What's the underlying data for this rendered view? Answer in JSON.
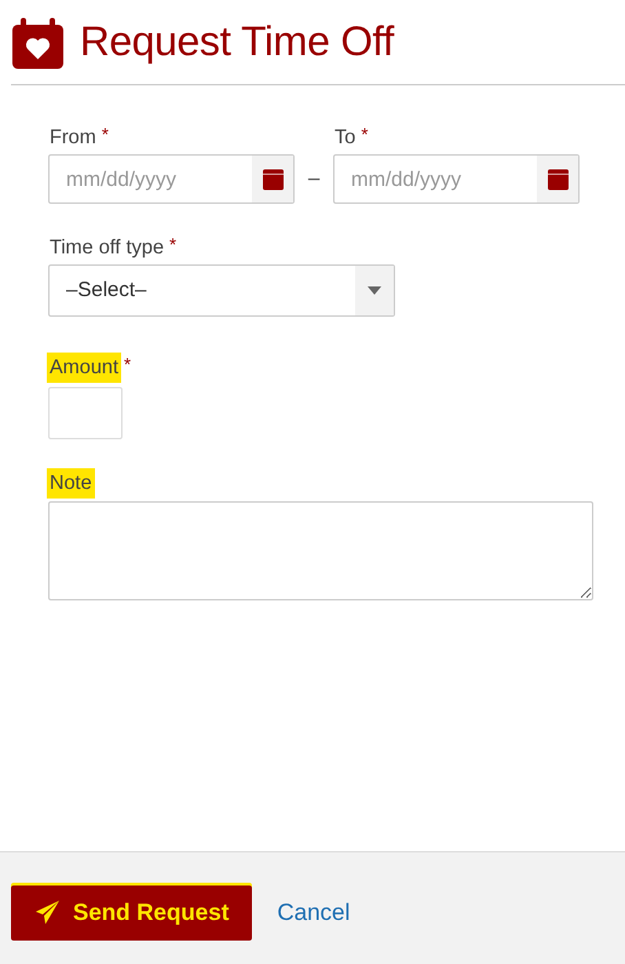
{
  "header": {
    "title": "Request Time Off"
  },
  "date_range": {
    "from": {
      "label": "From",
      "required_mark": "*",
      "placeholder": "mm/dd/yyyy",
      "highlighted": false
    },
    "separator": "–",
    "to": {
      "label": "To",
      "required_mark": "*",
      "placeholder": "mm/dd/yyyy",
      "highlighted": false
    }
  },
  "time_off_type": {
    "label": "Time off type",
    "required_mark": "*",
    "value": "–Select–",
    "highlighted": false
  },
  "amount": {
    "label": "Amount",
    "required_mark": "*",
    "highlighted": true
  },
  "note": {
    "label": "Note",
    "highlighted": true
  },
  "footer": {
    "send_button": {
      "label": "Send Request",
      "highlighted": true
    },
    "cancel_link": "Cancel"
  }
}
